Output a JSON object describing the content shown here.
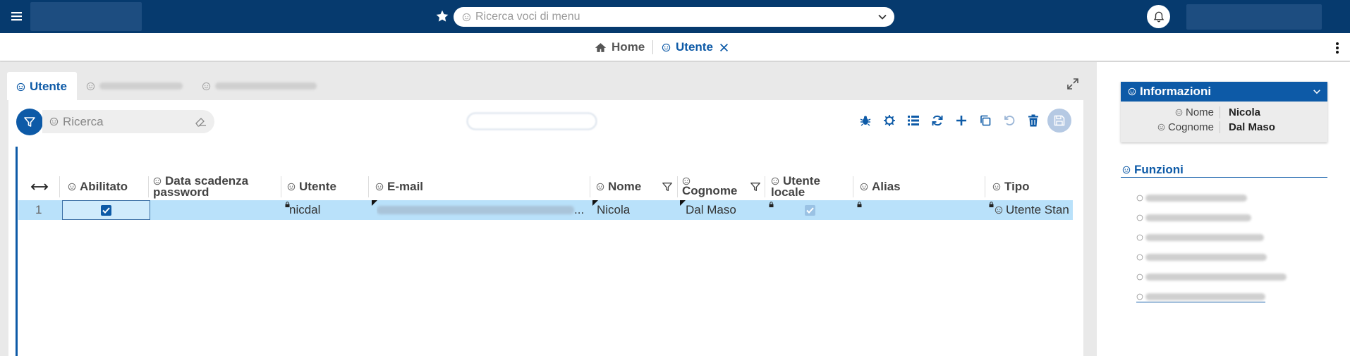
{
  "topbar": {
    "search_placeholder": "Ricerca voci di menu"
  },
  "breadcrumb": {
    "home": "Home",
    "current": "Utente"
  },
  "tabs": [
    {
      "label": "Utente",
      "active": true
    }
  ],
  "toolbar": {
    "search_placeholder": "Ricerca"
  },
  "grid": {
    "columns": {
      "abilitato": "Abilitato",
      "data_scadenza_1": "Data scadenza",
      "data_scadenza_2": "password",
      "utente": "Utente",
      "email": "E-mail",
      "nome": "Nome",
      "cognome": "Cognome",
      "utente_locale_1": "Utente",
      "utente_locale_2": "locale",
      "alias": "Alias",
      "tipo": "Tipo"
    },
    "rows": [
      {
        "index": "1",
        "abilitato": true,
        "utente": "nicdal",
        "email_suffix": "...",
        "nome": "Nicola",
        "cognome": "Dal Maso",
        "utente_locale": true,
        "tipo": "Utente Stan"
      }
    ]
  },
  "info": {
    "title": "Informazioni",
    "fields": [
      {
        "label": "Nome",
        "value": "Nicola"
      },
      {
        "label": "Cognome",
        "value": "Dal Maso"
      }
    ]
  },
  "funzioni": {
    "title": "Funzioni"
  },
  "colors": {
    "brand": "#063a6e",
    "accent": "#0d5aa7",
    "selected_row": "#b9e1fa"
  }
}
